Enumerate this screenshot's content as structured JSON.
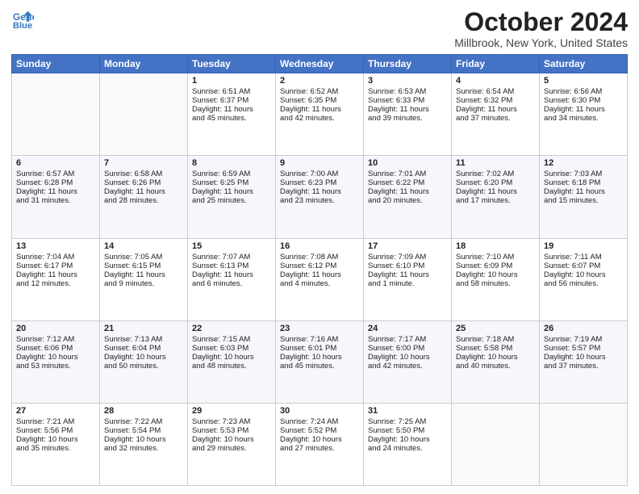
{
  "header": {
    "logo_line1": "General",
    "logo_line2": "Blue",
    "month": "October 2024",
    "location": "Millbrook, New York, United States"
  },
  "days_of_week": [
    "Sunday",
    "Monday",
    "Tuesday",
    "Wednesday",
    "Thursday",
    "Friday",
    "Saturday"
  ],
  "weeks": [
    [
      {
        "day": "",
        "lines": []
      },
      {
        "day": "",
        "lines": []
      },
      {
        "day": "1",
        "lines": [
          "Sunrise: 6:51 AM",
          "Sunset: 6:37 PM",
          "Daylight: 11 hours",
          "and 45 minutes."
        ]
      },
      {
        "day": "2",
        "lines": [
          "Sunrise: 6:52 AM",
          "Sunset: 6:35 PM",
          "Daylight: 11 hours",
          "and 42 minutes."
        ]
      },
      {
        "day": "3",
        "lines": [
          "Sunrise: 6:53 AM",
          "Sunset: 6:33 PM",
          "Daylight: 11 hours",
          "and 39 minutes."
        ]
      },
      {
        "day": "4",
        "lines": [
          "Sunrise: 6:54 AM",
          "Sunset: 6:32 PM",
          "Daylight: 11 hours",
          "and 37 minutes."
        ]
      },
      {
        "day": "5",
        "lines": [
          "Sunrise: 6:56 AM",
          "Sunset: 6:30 PM",
          "Daylight: 11 hours",
          "and 34 minutes."
        ]
      }
    ],
    [
      {
        "day": "6",
        "lines": [
          "Sunrise: 6:57 AM",
          "Sunset: 6:28 PM",
          "Daylight: 11 hours",
          "and 31 minutes."
        ]
      },
      {
        "day": "7",
        "lines": [
          "Sunrise: 6:58 AM",
          "Sunset: 6:26 PM",
          "Daylight: 11 hours",
          "and 28 minutes."
        ]
      },
      {
        "day": "8",
        "lines": [
          "Sunrise: 6:59 AM",
          "Sunset: 6:25 PM",
          "Daylight: 11 hours",
          "and 25 minutes."
        ]
      },
      {
        "day": "9",
        "lines": [
          "Sunrise: 7:00 AM",
          "Sunset: 6:23 PM",
          "Daylight: 11 hours",
          "and 23 minutes."
        ]
      },
      {
        "day": "10",
        "lines": [
          "Sunrise: 7:01 AM",
          "Sunset: 6:22 PM",
          "Daylight: 11 hours",
          "and 20 minutes."
        ]
      },
      {
        "day": "11",
        "lines": [
          "Sunrise: 7:02 AM",
          "Sunset: 6:20 PM",
          "Daylight: 11 hours",
          "and 17 minutes."
        ]
      },
      {
        "day": "12",
        "lines": [
          "Sunrise: 7:03 AM",
          "Sunset: 6:18 PM",
          "Daylight: 11 hours",
          "and 15 minutes."
        ]
      }
    ],
    [
      {
        "day": "13",
        "lines": [
          "Sunrise: 7:04 AM",
          "Sunset: 6:17 PM",
          "Daylight: 11 hours",
          "and 12 minutes."
        ]
      },
      {
        "day": "14",
        "lines": [
          "Sunrise: 7:05 AM",
          "Sunset: 6:15 PM",
          "Daylight: 11 hours",
          "and 9 minutes."
        ]
      },
      {
        "day": "15",
        "lines": [
          "Sunrise: 7:07 AM",
          "Sunset: 6:13 PM",
          "Daylight: 11 hours",
          "and 6 minutes."
        ]
      },
      {
        "day": "16",
        "lines": [
          "Sunrise: 7:08 AM",
          "Sunset: 6:12 PM",
          "Daylight: 11 hours",
          "and 4 minutes."
        ]
      },
      {
        "day": "17",
        "lines": [
          "Sunrise: 7:09 AM",
          "Sunset: 6:10 PM",
          "Daylight: 11 hours",
          "and 1 minute."
        ]
      },
      {
        "day": "18",
        "lines": [
          "Sunrise: 7:10 AM",
          "Sunset: 6:09 PM",
          "Daylight: 10 hours",
          "and 58 minutes."
        ]
      },
      {
        "day": "19",
        "lines": [
          "Sunrise: 7:11 AM",
          "Sunset: 6:07 PM",
          "Daylight: 10 hours",
          "and 56 minutes."
        ]
      }
    ],
    [
      {
        "day": "20",
        "lines": [
          "Sunrise: 7:12 AM",
          "Sunset: 6:06 PM",
          "Daylight: 10 hours",
          "and 53 minutes."
        ]
      },
      {
        "day": "21",
        "lines": [
          "Sunrise: 7:13 AM",
          "Sunset: 6:04 PM",
          "Daylight: 10 hours",
          "and 50 minutes."
        ]
      },
      {
        "day": "22",
        "lines": [
          "Sunrise: 7:15 AM",
          "Sunset: 6:03 PM",
          "Daylight: 10 hours",
          "and 48 minutes."
        ]
      },
      {
        "day": "23",
        "lines": [
          "Sunrise: 7:16 AM",
          "Sunset: 6:01 PM",
          "Daylight: 10 hours",
          "and 45 minutes."
        ]
      },
      {
        "day": "24",
        "lines": [
          "Sunrise: 7:17 AM",
          "Sunset: 6:00 PM",
          "Daylight: 10 hours",
          "and 42 minutes."
        ]
      },
      {
        "day": "25",
        "lines": [
          "Sunrise: 7:18 AM",
          "Sunset: 5:58 PM",
          "Daylight: 10 hours",
          "and 40 minutes."
        ]
      },
      {
        "day": "26",
        "lines": [
          "Sunrise: 7:19 AM",
          "Sunset: 5:57 PM",
          "Daylight: 10 hours",
          "and 37 minutes."
        ]
      }
    ],
    [
      {
        "day": "27",
        "lines": [
          "Sunrise: 7:21 AM",
          "Sunset: 5:56 PM",
          "Daylight: 10 hours",
          "and 35 minutes."
        ]
      },
      {
        "day": "28",
        "lines": [
          "Sunrise: 7:22 AM",
          "Sunset: 5:54 PM",
          "Daylight: 10 hours",
          "and 32 minutes."
        ]
      },
      {
        "day": "29",
        "lines": [
          "Sunrise: 7:23 AM",
          "Sunset: 5:53 PM",
          "Daylight: 10 hours",
          "and 29 minutes."
        ]
      },
      {
        "day": "30",
        "lines": [
          "Sunrise: 7:24 AM",
          "Sunset: 5:52 PM",
          "Daylight: 10 hours",
          "and 27 minutes."
        ]
      },
      {
        "day": "31",
        "lines": [
          "Sunrise: 7:25 AM",
          "Sunset: 5:50 PM",
          "Daylight: 10 hours",
          "and 24 minutes."
        ]
      },
      {
        "day": "",
        "lines": []
      },
      {
        "day": "",
        "lines": []
      }
    ]
  ]
}
